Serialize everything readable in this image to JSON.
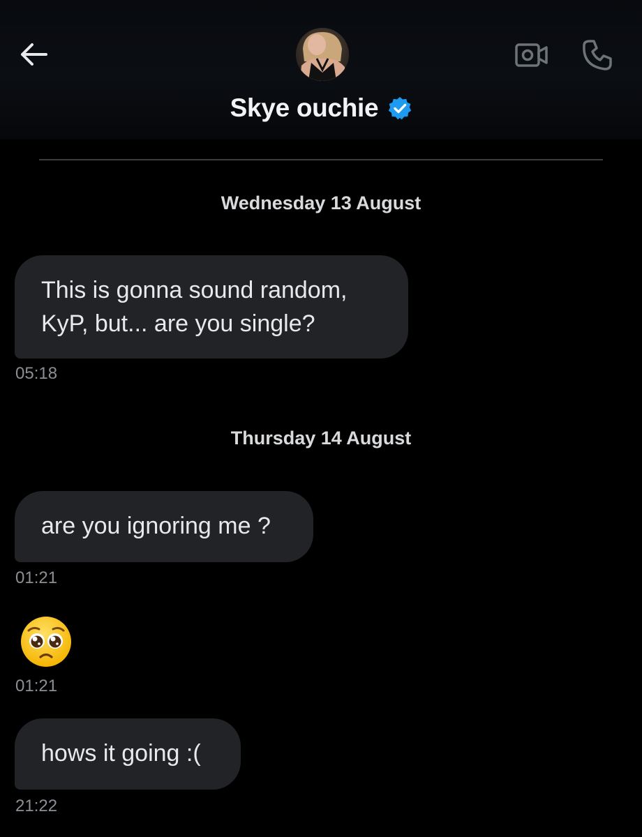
{
  "header": {
    "contact_name": "Skye ouchie",
    "verified": true,
    "accent_color": "#1d9bf0"
  },
  "icons": {
    "back": "arrow-left-icon",
    "video": "video-camera-icon",
    "phone": "phone-icon",
    "verified": "verified-badge-icon"
  },
  "messages": [
    {
      "date_separator": "Wednesday 13 August",
      "lines": [
        "This is gonna sound random,",
        "KyP, but... are you single?"
      ],
      "time": "05:18"
    },
    {
      "date_separator": "Thursday 14 August",
      "lines": [
        "are you ignoring me ?"
      ],
      "time": "01:21"
    },
    {
      "emoji": "pleading-face-emoji",
      "time": "01:21"
    },
    {
      "lines": [
        "hows it going :("
      ],
      "time": "21:22"
    }
  ]
}
